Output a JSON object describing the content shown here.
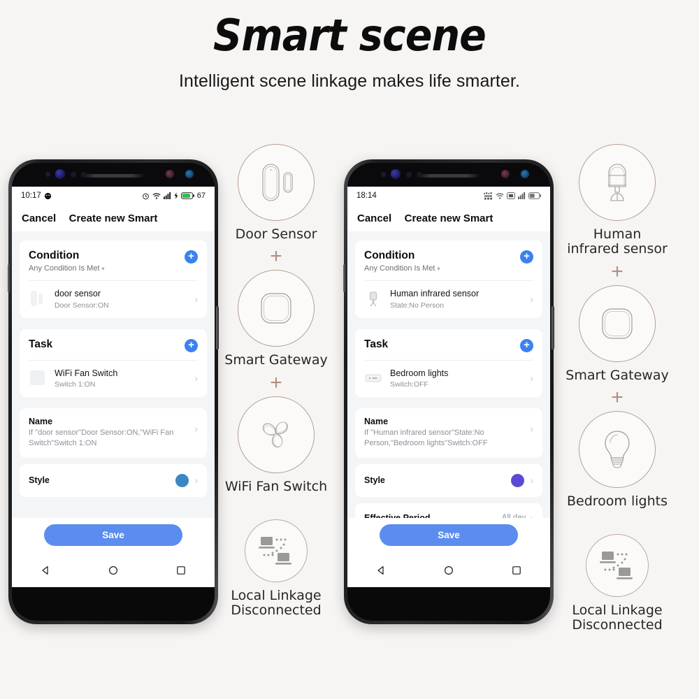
{
  "header": {
    "title": "Smart scene",
    "subtitle": "Intelligent scene linkage makes life smarter."
  },
  "phones": [
    {
      "id": "phone-left",
      "statusbar": {
        "time": "10:17",
        "battery_percent": "67",
        "icons": [
          "smile-icon",
          "alarm-icon",
          "wifi-icon",
          "signal-icon",
          "charging-icon",
          "battery-icon"
        ]
      },
      "appbar": {
        "cancel_label": "Cancel",
        "title": "Create new Smart"
      },
      "condition": {
        "heading": "Condition",
        "mode": "Any Condition Is Met",
        "add_label": "+",
        "items": [
          {
            "title": "door sensor",
            "subtitle": "Door Sensor:ON",
            "icon": "door-sensor-icon"
          }
        ]
      },
      "task": {
        "heading": "Task",
        "add_label": "+",
        "items": [
          {
            "title": "WiFi Fan Switch",
            "subtitle": "Switch 1:ON",
            "icon": "fan-switch-icon"
          }
        ]
      },
      "name": {
        "label": "Name",
        "description": "If \"door sensor\"Door Sensor:ON,\"WiFi Fan Switch\"Switch 1:ON"
      },
      "style": {
        "label": "Style",
        "color": "#3b87c4"
      },
      "effective_period": null,
      "save_label": "Save",
      "nav": [
        "back-icon",
        "home-icon",
        "recents-icon"
      ]
    },
    {
      "id": "phone-right",
      "statusbar": {
        "time": "18:14",
        "battery_percent": "",
        "icons": [
          "network-icon",
          "wifi-icon",
          "screenshot-icon",
          "signal-icon",
          "battery-icon"
        ]
      },
      "appbar": {
        "cancel_label": "Cancel",
        "title": "Create new Smart"
      },
      "condition": {
        "heading": "Condition",
        "mode": "Any Condition Is Met",
        "add_label": "+",
        "items": [
          {
            "title": "Human infrared sensor",
            "subtitle": "State:No Person",
            "icon": "pir-sensor-icon"
          }
        ]
      },
      "task": {
        "heading": "Task",
        "add_label": "+",
        "items": [
          {
            "title": "Bedroom lights",
            "subtitle": "Switch:OFF",
            "icon": "light-strip-icon"
          }
        ]
      },
      "name": {
        "label": "Name",
        "description": "If \"Human infrared sensor\"State:No Person,\"Bedroom lights\"Switch:OFF"
      },
      "style": {
        "label": "Style",
        "color": "#5b4bd4"
      },
      "effective_period": {
        "label": "Effective Period",
        "value": "All day"
      },
      "save_label": "Save",
      "nav": [
        "back-icon",
        "home-icon",
        "recents-icon"
      ]
    }
  ],
  "device_columns": [
    {
      "id": "devices-left",
      "items": [
        {
          "label": "Door Sensor",
          "icon": "door-sensor-icon",
          "size": "lg",
          "separator_after": "+"
        },
        {
          "label": "Smart Gateway",
          "icon": "gateway-icon",
          "size": "lg",
          "separator_after": "+"
        },
        {
          "label": "WiFi Fan Switch",
          "icon": "fan-icon",
          "size": "lg",
          "separator_after": ""
        },
        {
          "label": "Local Linkage\nDisconnected",
          "icon": "local-linkage-icon",
          "size": "sm",
          "separator_after": ""
        }
      ]
    },
    {
      "id": "devices-right",
      "items": [
        {
          "label": "Human\ninfrared sensor",
          "icon": "pir-sensor-icon",
          "size": "lg",
          "separator_after": "+"
        },
        {
          "label": "Smart Gateway",
          "icon": "gateway-icon",
          "size": "lg",
          "separator_after": "+"
        },
        {
          "label": "Bedroom lights",
          "icon": "bulb-icon",
          "size": "lg",
          "separator_after": ""
        },
        {
          "label": "Local Linkage\nDisconnected",
          "icon": "local-linkage-icon",
          "size": "sm",
          "separator_after": ""
        }
      ]
    }
  ],
  "colors": {
    "background": "#f7f5f3",
    "accent_blue": "#3b82f0",
    "save_blue": "#5b8def",
    "icon_line": "#b79f93"
  }
}
